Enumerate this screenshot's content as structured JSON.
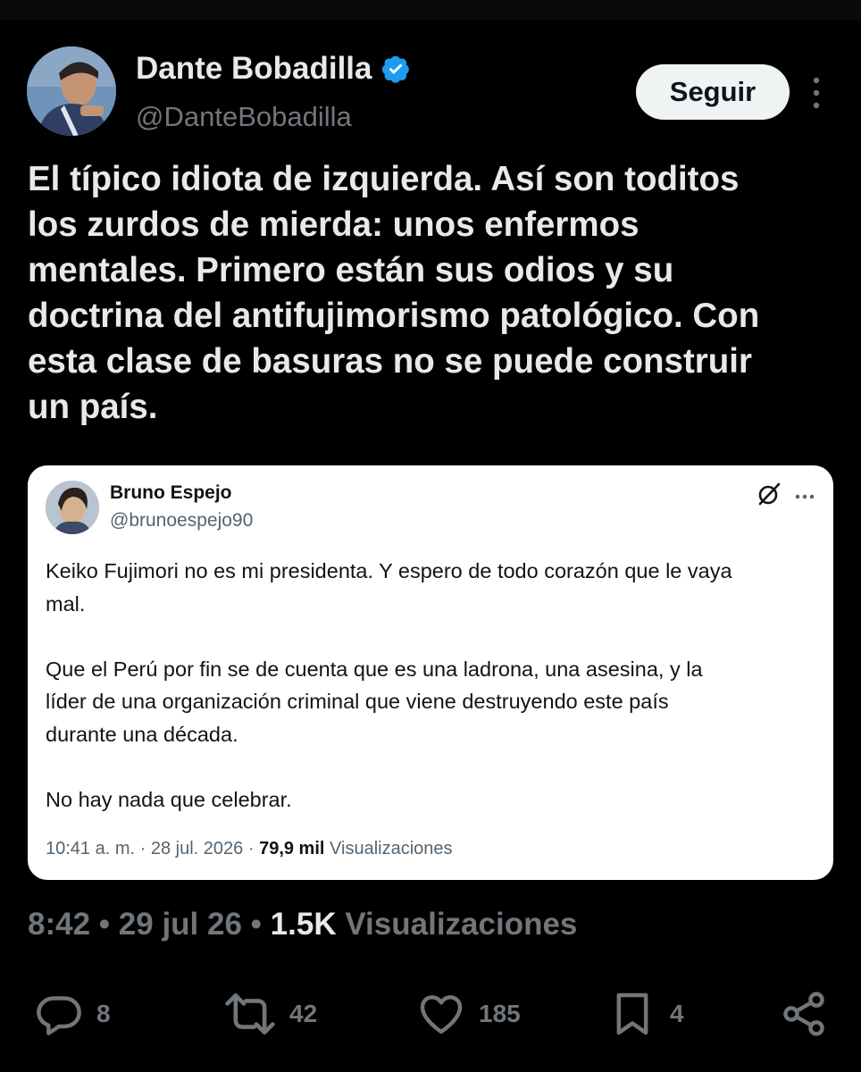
{
  "author": {
    "display_name": "Dante Bobadilla",
    "handle": "@DanteBobadilla",
    "verified": true
  },
  "follow_label": "Seguir",
  "tweet_text": "El típico idiota de izquierda. Así son toditos\nlos zurdos de mierda: unos enfermos\nmentales. Primero están sus odios y su\ndoctrina del antifujimorismo patológico. Con\nesta clase de basuras no se puede construir\nun país.",
  "quoted": {
    "display_name": "Bruno Espejo",
    "handle": "@brunoespejo90",
    "text": "Keiko Fujimori no es mi presidenta. Y espero de todo corazón que le vaya\nmal.\n\nQue el Perú por fin se de cuenta que es una ladrona, una asesina, y la\nlíder de una organización criminal que viene destruyendo este país\ndurante una década.\n\nNo hay nada que celebrar.",
    "time": "10:41 a. m.",
    "date": "28 jul. 2026",
    "views": "79,9 mil",
    "views_label": "Visualizaciones",
    "sep": "·"
  },
  "meta": {
    "time": "8:42",
    "date": "29 jul 26",
    "views": "1.5K",
    "views_label": "Visualizaciones",
    "sep": "•"
  },
  "actions": {
    "replies": "8",
    "reposts": "42",
    "likes": "185",
    "bookmarks": "4"
  },
  "colors": {
    "background": "#000000",
    "text": "#e7e9ea",
    "muted": "#71767b",
    "verified": "#1d9bf0",
    "card": "#ffffff"
  }
}
